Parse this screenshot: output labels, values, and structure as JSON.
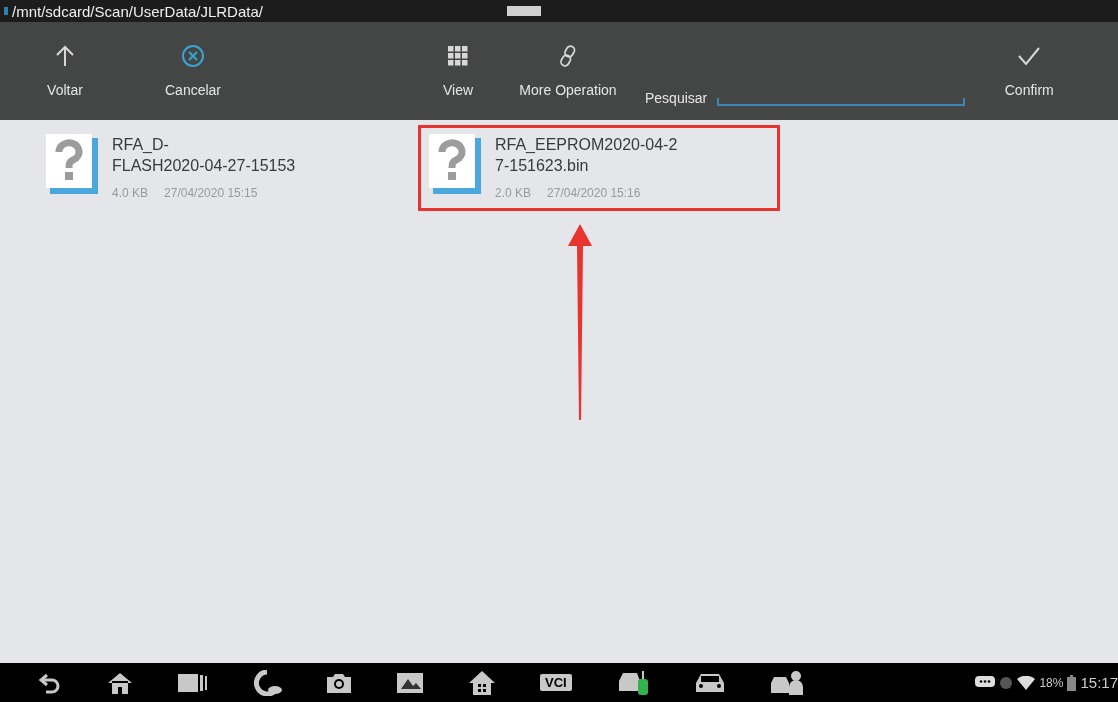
{
  "path_bar": {
    "path": "/mnt/sdcard/Scan/UserData/JLRData/"
  },
  "toolbar": [
    {
      "kind": "up",
      "label": "Voltar"
    },
    {
      "kind": "cancel",
      "label": "Cancelar"
    },
    {
      "kind": "grid",
      "label": "View"
    },
    {
      "kind": "link",
      "label": "More Operation"
    },
    {
      "kind": "search",
      "label": "Pesquisar"
    },
    {
      "kind": "check",
      "label": "Confirm"
    }
  ],
  "files": [
    {
      "name": "RFA_D-\nFLASH2020-04-27-15153",
      "size": "4.0 KB",
      "date": "27/04/2020 15:15",
      "highlighted": false
    },
    {
      "name": "RFA_EEPROM2020-04-2\n7-151623.bin",
      "size": "2.0 KB",
      "date": "27/04/2020 15:16",
      "highlighted": true
    }
  ],
  "nav_bar": {
    "buttons": [
      {
        "kind": "back"
      },
      {
        "kind": "home"
      },
      {
        "kind": "recents"
      },
      {
        "kind": "cloud"
      },
      {
        "kind": "camera"
      },
      {
        "kind": "image"
      },
      {
        "kind": "house"
      },
      {
        "kind": "vci",
        "label": "VCI"
      },
      {
        "kind": "car-green"
      },
      {
        "kind": "car"
      },
      {
        "kind": "car-person"
      }
    ],
    "status": {
      "battery": "18%",
      "time": "15:17"
    }
  }
}
